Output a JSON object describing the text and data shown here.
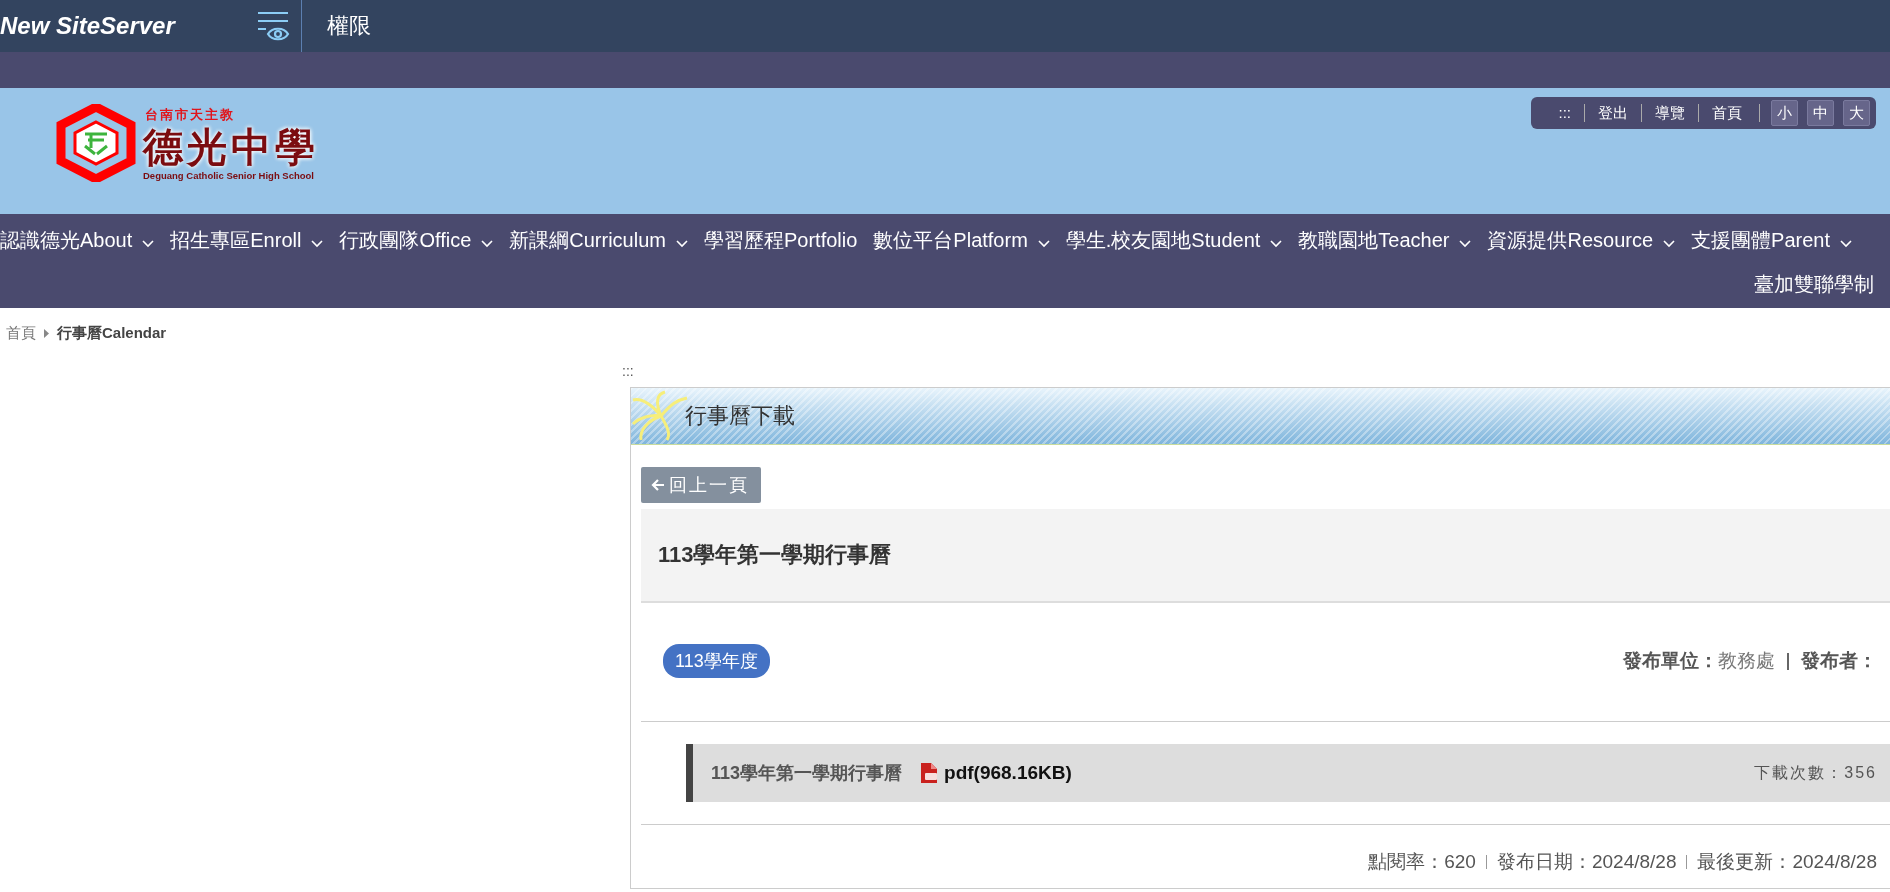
{
  "topbar": {
    "brand": "New SiteServer",
    "title": "權限"
  },
  "logo": {
    "city": "台南市天主教",
    "name": "德光中學",
    "english": "Deguang Catholic Senior High School"
  },
  "quick_links": {
    "skip": ":::",
    "links": [
      "登出",
      "導覽",
      "首頁"
    ],
    "font_sizes": [
      "小",
      "中",
      "大"
    ]
  },
  "nav": [
    {
      "label": "認識德光About",
      "dropdown": true
    },
    {
      "label": "招生專區Enroll",
      "dropdown": true
    },
    {
      "label": "行政團隊Office",
      "dropdown": true
    },
    {
      "label": "新課綱Curriculum",
      "dropdown": true
    },
    {
      "label": "學習歷程Portfolio",
      "dropdown": false
    },
    {
      "label": "數位平台Platform",
      "dropdown": true
    },
    {
      "label": "學生.校友園地Student",
      "dropdown": true
    },
    {
      "label": "教職園地Teacher",
      "dropdown": true
    },
    {
      "label": "資源提供Resource",
      "dropdown": true
    },
    {
      "label": "支援團體Parent",
      "dropdown": true
    }
  ],
  "nav_extra": "臺加雙聯學制",
  "breadcrumb": [
    "首頁",
    "行事曆Calendar"
  ],
  "skip_mark": ":::",
  "panel": {
    "title": "行事曆下載",
    "back_button": "回上一頁",
    "article_title": "113學年第一學期行事曆",
    "tag": "113學年度",
    "publish_unit_label": "發布單位：",
    "publish_unit": "教務處",
    "publisher_label": "發布者：",
    "file": {
      "name": "113學年第一學期行事曆",
      "link": "pdf(968.16KB)",
      "downloads": "下載次數：356"
    },
    "stats": [
      "點閱率：620",
      "發布日期：2024/8/28",
      "最後更新：2024/8/28"
    ]
  }
}
